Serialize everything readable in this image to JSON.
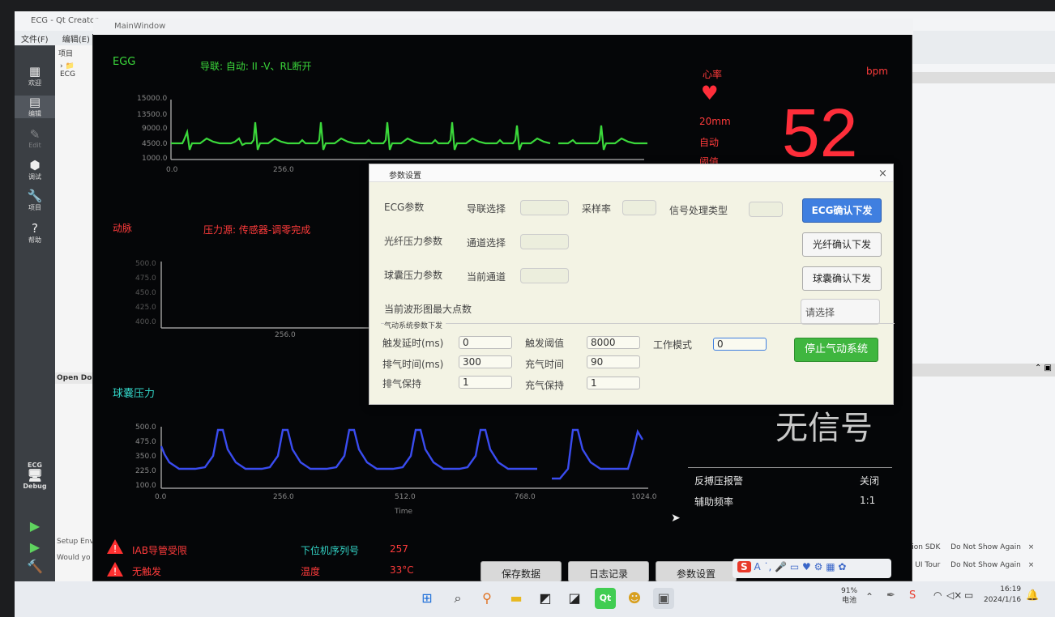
{
  "qt_creator": {
    "title": "ECG - Qt Creator",
    "menu": [
      "文件(F)",
      "编辑(E)"
    ],
    "sidebar": [
      {
        "label": "欢迎",
        "glyph": "▦"
      },
      {
        "label": "编辑",
        "glyph": "▤"
      },
      {
        "label": "Edit",
        "glyph": "✎"
      },
      {
        "label": "调试",
        "glyph": "⬢"
      },
      {
        "label": "项目",
        "glyph": "🔧"
      },
      {
        "label": "帮助",
        "glyph": "?"
      }
    ],
    "kit_label": "ECG",
    "kit_mode": "Debug",
    "project_header": "项目",
    "project_item": "ECG",
    "open_docs": "Open Do",
    "setup_text": "Setup Env",
    "would_text": "Would yo",
    "notifications": [
      {
        "text": "ption SDK",
        "action": "Do Not Show Again"
      },
      {
        "text": "ke UI Tour",
        "action": "Do Not Show Again"
      }
    ]
  },
  "main_window": {
    "title": "MainWindow",
    "ecg": {
      "label": "EGG",
      "lead_info": "导联: 自动: II  -V、RL断开",
      "y_ticks": [
        "15000.0",
        "13500.0",
        "9000.0",
        "4500.0",
        "1000.0"
      ],
      "x_ticks": [
        "0.0",
        "256.0"
      ]
    },
    "artery": {
      "label": "动脉",
      "source": "压力源: 传感器-调零完成",
      "y_ticks": [
        "500.0",
        "475.0",
        "450.0",
        "425.0",
        "400.0"
      ],
      "x_ticks": [
        "256.0"
      ]
    },
    "balloon": {
      "label": "球囊压力",
      "y_ticks": [
        "500.0",
        "475.0",
        "350.0",
        "225.0",
        "100.0"
      ],
      "x_ticks": [
        "0.0",
        "256.0",
        "512.0",
        "768.0",
        "1024.0"
      ],
      "x_label": "Time"
    },
    "heart_rate": {
      "label": "心率",
      "unit": "bpm",
      "scale": "20mm",
      "mode": "自动",
      "threshold": "阈值",
      "value": "52"
    },
    "no_signal": "无信号",
    "settings": [
      {
        "label": "反搏压报警",
        "value": "关闭"
      },
      {
        "label": "辅助频率",
        "value": "1:1"
      }
    ],
    "alarms": [
      {
        "icon": "warning-icon",
        "text": "IAB导管受限"
      },
      {
        "icon": "warning-icon",
        "text": "无触发"
      }
    ],
    "serial_label": "下位机序列号",
    "serial_value": "257",
    "temp_label": "温度",
    "temp_value": "33°C",
    "bottom_buttons": [
      "保存数据",
      "日志记录",
      "参数设置"
    ]
  },
  "dialog": {
    "title": "参数设置",
    "ecg_params": "ECG参数",
    "lead_select": "导联选择",
    "sample_rate": "采样率",
    "signal_type": "信号处理类型",
    "ecg_confirm": "ECG确认下发",
    "fiber_params": "光纤压力参数",
    "channel_select": "通道选择",
    "fiber_confirm": "光纤确认下发",
    "balloon_params": "球囊压力参数",
    "current_channel": "当前通道",
    "balloon_confirm": "球囊确认下发",
    "max_points": "当前波形图最大点数",
    "select_placeholder": "请选择",
    "pneumatic_group": "气动系统参数下发",
    "trigger_delay_label": "触发延时(ms)",
    "trigger_delay": "0",
    "trigger_threshold_label": "触发阈值",
    "trigger_threshold": "8000",
    "work_mode_label": "工作模式",
    "work_mode": "0",
    "exhaust_time_label": "排气时间(ms)",
    "exhaust_time": "300",
    "inflate_time_label": "充气时间",
    "inflate_time": "90",
    "exhaust_hold_label": "排气保持",
    "exhaust_hold": "1",
    "inflate_hold_label": "充气保持",
    "inflate_hold": "1",
    "stop_button": "停止气动系统",
    "close": "×"
  },
  "taskbar": {
    "battery_pct": "91%",
    "battery_label": "电池",
    "time": "16:19",
    "date": "2024/1/16"
  },
  "colors": {
    "ecg_wave": "#3bd83b",
    "balloon_wave": "#3a4cf0",
    "alarm_red": "#ff3b3b",
    "heart_red": "#ff2e3a",
    "stop_green": "#3fb63f",
    "ecg_button_blue": "#3f7fe0"
  }
}
